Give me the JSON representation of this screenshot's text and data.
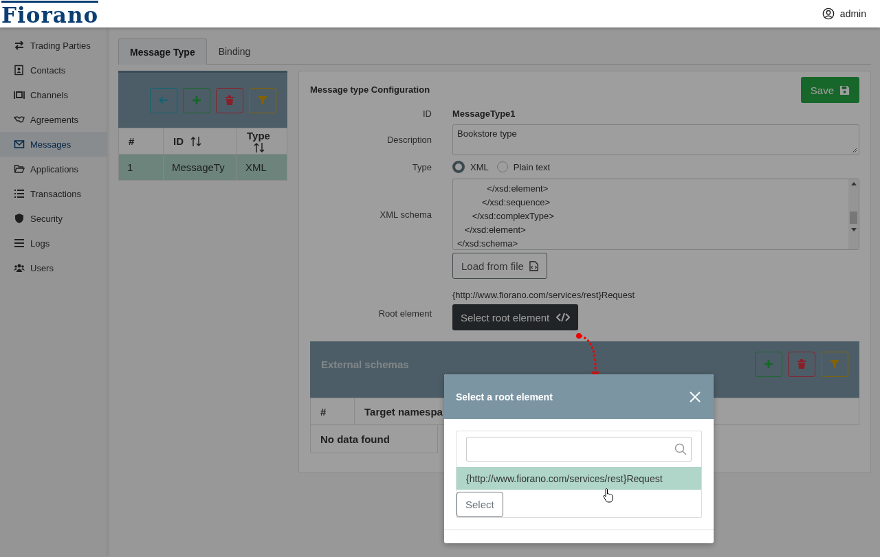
{
  "header": {
    "logo": "Fiorano",
    "user": "admin"
  },
  "sidebar": {
    "items": [
      {
        "label": "Trading Parties",
        "selected": false
      },
      {
        "label": "Contacts",
        "selected": false
      },
      {
        "label": "Channels",
        "selected": false
      },
      {
        "label": "Agreements",
        "selected": false
      },
      {
        "label": "Messages",
        "selected": true
      },
      {
        "label": "Applications",
        "selected": false
      },
      {
        "label": "Transactions",
        "selected": false
      },
      {
        "label": "Security",
        "selected": false
      },
      {
        "label": "Logs",
        "selected": false
      },
      {
        "label": "Users",
        "selected": false
      }
    ]
  },
  "tabs": [
    {
      "label": "Message Type",
      "selected": true
    },
    {
      "label": "Binding",
      "selected": false
    }
  ],
  "list_panel": {
    "columns": [
      "#",
      "ID",
      "Type"
    ],
    "rows": [
      {
        "cells": [
          "1",
          "MessageTy",
          "XML"
        ],
        "selected": true
      }
    ]
  },
  "config": {
    "title": "Message type Configuration",
    "save_button": "Save",
    "id_label": "ID",
    "id_value": "MessageType1",
    "description_label": "Description",
    "description_value": "Bookstore type",
    "type_label": "Type",
    "type_options": [
      {
        "label": "XML",
        "selected": true
      },
      {
        "label": "Plain text",
        "selected": false
      }
    ],
    "schema_label": "XML schema",
    "schema_lines": [
      "            </xsd:element>",
      "          </xsd:sequence>",
      "      </xsd:complexType>",
      "   </xsd:element>",
      "</xsd:schema>"
    ],
    "load_button": "Load from file",
    "root_label": "Root element",
    "root_value": "{http://www.fiorano.com/services/rest}Request",
    "root_button": "Select root element"
  },
  "external_schemas": {
    "title": "External schemas",
    "columns": [
      "#",
      "Target namespa"
    ],
    "empty_text": "No data found"
  },
  "modal": {
    "title": "Select a root element",
    "options": [
      {
        "label": "{http://www.fiorano.com/services/rest}Request",
        "selected": true
      }
    ],
    "select_button": "Select"
  }
}
